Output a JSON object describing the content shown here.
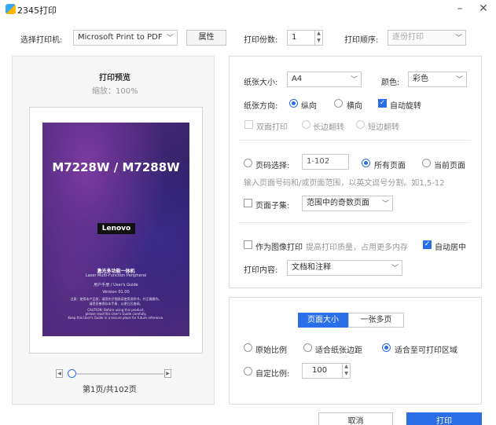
{
  "window": {
    "title": "2345打印",
    "minimize": "–",
    "close": "✕"
  },
  "top": {
    "printer_label": "选择打印机:",
    "printer_value": "Microsoft Print to PDF",
    "properties_label": "属性",
    "copies_label": "打印份数:",
    "copies_value": "1",
    "order_label": "打印顺序:",
    "order_value": "逐份打印"
  },
  "preview": {
    "title": "打印预览",
    "zoom": "缩放：100%",
    "page_indicator": "第1页/共102页",
    "slider_position": 0,
    "cover": {
      "model": "M7228W / M7288W",
      "brand": "Lenovo",
      "product_cn": "激光多功能一体机",
      "product_en": "Laser Multi-Function Peripheral",
      "guide": "用户手册 / User's Guide",
      "version": "Version 01.00",
      "notice1": "注意：使用本产品前，请您先仔细阅读使用说明书，并正确操作。",
      "notice2": "请您妥善保存本手册，以便日后查阅。",
      "caution1": "CAUTION: Before using this product,",
      "caution2": "please read this User's Guide carefully.",
      "caution3": "Keep this User's Guide in a secure place for future reference."
    }
  },
  "settings": {
    "paper_size_label": "纸张大小:",
    "paper_size_value": "A4",
    "color_label": "颜色:",
    "color_value": "彩色",
    "orientation_label": "纸张方向:",
    "portrait": "纵向",
    "landscape": "横向",
    "auto_rotate": "自动旋转",
    "duplex": "双面打印",
    "long_edge": "长边翻转",
    "short_edge": "短边翻转",
    "page_range_label": "页码选择:",
    "page_range_value": "1-102",
    "all_pages": "所有页面",
    "current_page": "当前页面",
    "range_hint": "输入页面号码和/或页面范围，以英文逗号分割。如1,5-12",
    "subset_label": "页面子集:",
    "subset_value": "范围中的奇数页面",
    "as_image": "作为图像打印",
    "as_image_hint": "提高打印质量，占用更多内存",
    "auto_center": "自动居中",
    "content_label": "打印内容:",
    "content_value": "文档和注释"
  },
  "scaling": {
    "tab_page_size": "页面大小",
    "tab_multi_page": "一张多页",
    "original": "原始比例",
    "fit_margin": "适合纸张边距",
    "fit_printable": "适合至可打印区域",
    "custom_label": "自定比例:",
    "custom_value": "100"
  },
  "footer": {
    "cancel": "取消",
    "print": "打印"
  },
  "colors": {
    "accent": "#2b6fe8"
  }
}
